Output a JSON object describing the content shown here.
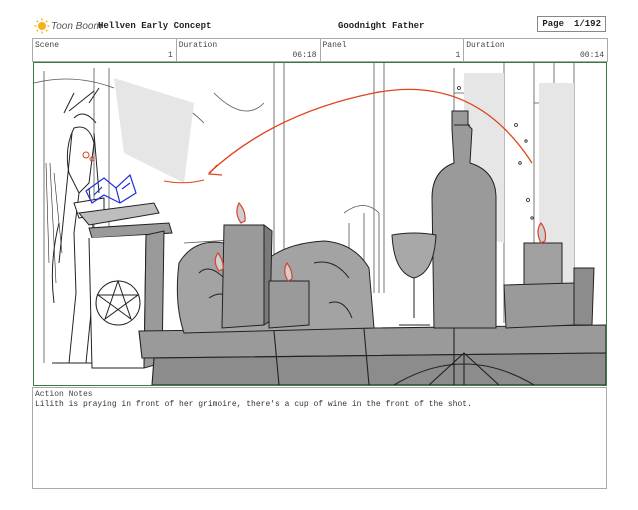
{
  "header": {
    "logo_text": "Toon Boom",
    "project": "Hellven  Early Concept",
    "title": "Goodnight Father",
    "page_label": "Page",
    "page_value": "1/192"
  },
  "info": {
    "scene_label": "Scene",
    "scene_value": "1",
    "duration1_label": "Duration",
    "duration1_value": "06:18",
    "panel_label": "Panel",
    "panel_value": "1",
    "duration2_label": "Duration",
    "duration2_value": "00:14"
  },
  "notes": {
    "label": "Action Notes",
    "text": "Lilith is praying in front of her grimoire, there's a cup of wine in the front of the shot."
  },
  "colors": {
    "panel_border": "#3a7a3a",
    "arrow": "#e0431f",
    "flame": "#d8412a",
    "book": "#1f2fd8",
    "fill_gray": "#9a9a9a"
  }
}
